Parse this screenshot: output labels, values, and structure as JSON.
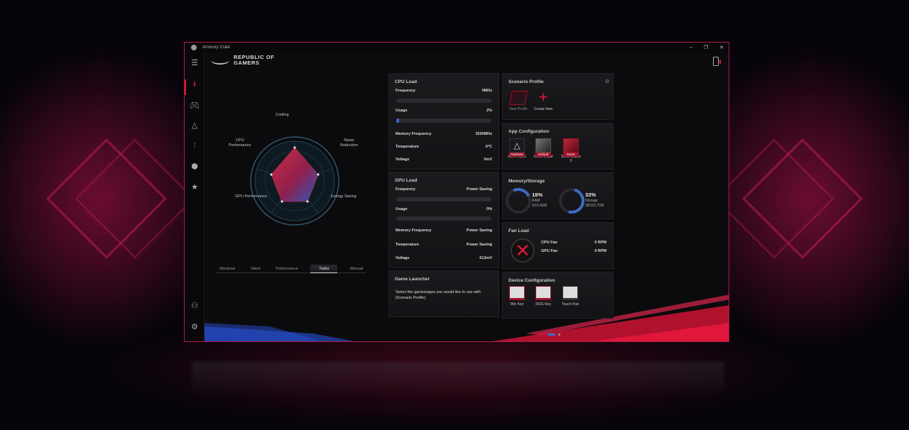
{
  "window": {
    "title": "Armoury Crate",
    "controls": [
      "–",
      "❐",
      "✕"
    ]
  },
  "brand": {
    "line1": "REPUBLIC OF",
    "line2": "GAMERS"
  },
  "sidebar": {
    "items": [
      "menu-icon",
      "home-icon",
      "gamepad-icon",
      "aura-icon",
      "sliders-icon",
      "box-icon",
      "star-icon",
      "user-icon",
      "gear-icon"
    ]
  },
  "radar": {
    "axes": [
      "Cooling",
      "Noise Reduction",
      "Energy Saving",
      "GPU Performance",
      "CPU Performance"
    ],
    "labels": {
      "cooling": "Cooling",
      "noise1": "Noise",
      "noise2": "Reduction",
      "energy": "Energy Saving",
      "gpu": "GPU Performance",
      "cpu1": "CPU",
      "cpu2": "Performance"
    }
  },
  "modes": {
    "items": [
      "Windows",
      "Silent",
      "Performance",
      "Turbo",
      "Manual"
    ],
    "selected": "Turbo"
  },
  "cpu": {
    "title": "CPU Load",
    "frequency_label": "Frequency",
    "frequency": "0MHz",
    "usage_label": "Usage",
    "usage": "2%",
    "usage_fraction": 0.02,
    "memfreq_label": "Memory Frequency",
    "memfreq": "3200MHz",
    "temp_label": "Temperature",
    "temp": "0°C",
    "volt_label": "Voltage",
    "volt": "0mV"
  },
  "gpu": {
    "title": "GPU Load",
    "frequency_label": "Frequency",
    "frequency": "Power Saving",
    "usage_label": "Usage",
    "usage": "0%",
    "memfreq_label": "Memory Frequency",
    "memfreq": "Power Saving",
    "temp_label": "Temperature",
    "temp": "Power Saving",
    "volt_label": "Voltage",
    "volt": "612mV"
  },
  "launcher": {
    "title": "Game Launcher",
    "text1": "Select the games/apps you would like to use with",
    "text2": "[Scenario Profile]."
  },
  "scenario": {
    "title": "Scenario Profile",
    "new_profile": "New Profile",
    "create_new": "Create New"
  },
  "appconfig": {
    "title": "App Configuration",
    "apps": [
      {
        "name": "AURA Sync",
        "tag": "Rainbow"
      },
      {
        "name": "GameVisual",
        "tag": "Default"
      },
      {
        "name1": "Sonic Studio",
        "name2": "3",
        "tag": "Music"
      }
    ]
  },
  "memory": {
    "title": "Memory/Storage",
    "ram_pct": "18%",
    "ram_label": "RAM",
    "ram_val": "3/15.4GB",
    "ram_fraction": 0.18,
    "storage_pct": "33%",
    "storage_label": "Storage",
    "storage_val": "38/115.7GB",
    "storage_fraction": 0.33
  },
  "fan": {
    "title": "Fan Load",
    "cpu_label": "CPU Fan",
    "cpu_val": "0 RPM",
    "gpu_label": "GPU Fan",
    "gpu_val": "0 RPM"
  },
  "device": {
    "title": "Device Configuration",
    "items": [
      "Win Key",
      "ROG Key",
      "Touch Pad"
    ]
  },
  "colors": {
    "accent": "#e0173a",
    "blue": "#3d6bc8"
  }
}
